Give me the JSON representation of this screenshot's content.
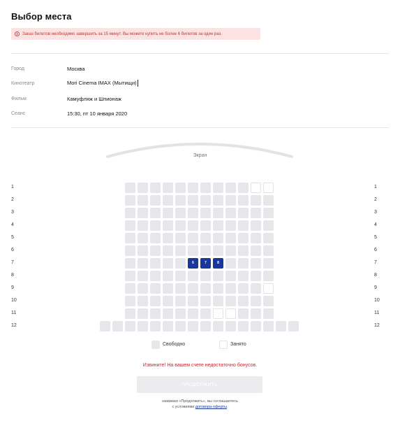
{
  "title": "Выбор места",
  "alert": {
    "text": "Заказ билетов необходимо завершить за 15 минут. Вы можете купить не более 6 билетов за один раз."
  },
  "info": [
    {
      "label": "Город",
      "value": "Москва"
    },
    {
      "label": "Кинотеатр",
      "value": "Mori Cinema IMAX (Мытищи)"
    },
    {
      "label": "Фильм",
      "value": "Камуфляж и Шпионаж"
    },
    {
      "label": "Сеанс",
      "value": "15:30, пт 10 января 2020"
    }
  ],
  "screen_label": "Экран",
  "rows": [
    "1",
    "2",
    "3",
    "4",
    "5",
    "6",
    "7",
    "8",
    "9",
    "10",
    "11",
    "12"
  ],
  "hall": [
    {
      "row": "1",
      "seats": [
        "f",
        "f",
        "f",
        "f",
        "f",
        "f",
        "f",
        "f",
        "f",
        "f",
        "t",
        "t"
      ]
    },
    {
      "row": "2",
      "seats": [
        "f",
        "f",
        "f",
        "f",
        "f",
        "f",
        "f",
        "f",
        "f",
        "f",
        "f",
        "f"
      ]
    },
    {
      "row": "3",
      "seats": [
        "f",
        "f",
        "f",
        "f",
        "f",
        "f",
        "f",
        "f",
        "f",
        "f",
        "f",
        "f"
      ]
    },
    {
      "row": "4",
      "seats": [
        "f",
        "f",
        "f",
        "f",
        "f",
        "f",
        "f",
        "f",
        "f",
        "f",
        "f",
        "f"
      ]
    },
    {
      "row": "5",
      "seats": [
        "f",
        "f",
        "f",
        "f",
        "f",
        "f",
        "f",
        "f",
        "f",
        "f",
        "f",
        "f"
      ]
    },
    {
      "row": "6",
      "seats": [
        "f",
        "f",
        "f",
        "f",
        "f",
        "f",
        "f",
        "f",
        "f",
        "f",
        "f",
        "f"
      ]
    },
    {
      "row": "7",
      "seats": [
        "f",
        "f",
        "f",
        "f",
        "f",
        "s",
        "s",
        "s",
        "f",
        "f",
        "f",
        "f"
      ]
    },
    {
      "row": "8",
      "seats": [
        "f",
        "f",
        "f",
        "f",
        "f",
        "f",
        "f",
        "f",
        "f",
        "f",
        "f",
        "f"
      ]
    },
    {
      "row": "9",
      "seats": [
        "f",
        "f",
        "f",
        "f",
        "f",
        "f",
        "f",
        "f",
        "f",
        "f",
        "f",
        "t"
      ]
    },
    {
      "row": "10",
      "seats": [
        "f",
        "f",
        "f",
        "f",
        "f",
        "f",
        "f",
        "f",
        "f",
        "f",
        "f",
        "f"
      ]
    },
    {
      "row": "11",
      "seats": [
        "f",
        "f",
        "f",
        "f",
        "f",
        "f",
        "f",
        "t",
        "t",
        "f",
        "f",
        "f"
      ]
    },
    {
      "row": "12",
      "seats": [
        "f",
        "f",
        "f",
        "f",
        "f",
        "f",
        "f",
        "f",
        "f",
        "f",
        "f",
        "f",
        "f",
        "f",
        "f",
        "f"
      ]
    }
  ],
  "selected_labels": [
    "6",
    "7",
    "8"
  ],
  "legend": {
    "free": "Свободно",
    "taken": "Занято"
  },
  "error": "Извините! На вашем счете недостаточно бонусов.",
  "button": "ПРОДОЛЖИТЬ",
  "note": {
    "line1": "нажимая «Продолжить», вы соглашаетесь",
    "line2_prefix": "с условиями",
    "link": "договора-оферты",
    "line2_suffix": "."
  },
  "colors": {
    "seat_free": "#e6e7ea",
    "seat_selected": "#17379a",
    "error": "#d0232f",
    "alert_bg": "#fbe3e3"
  }
}
